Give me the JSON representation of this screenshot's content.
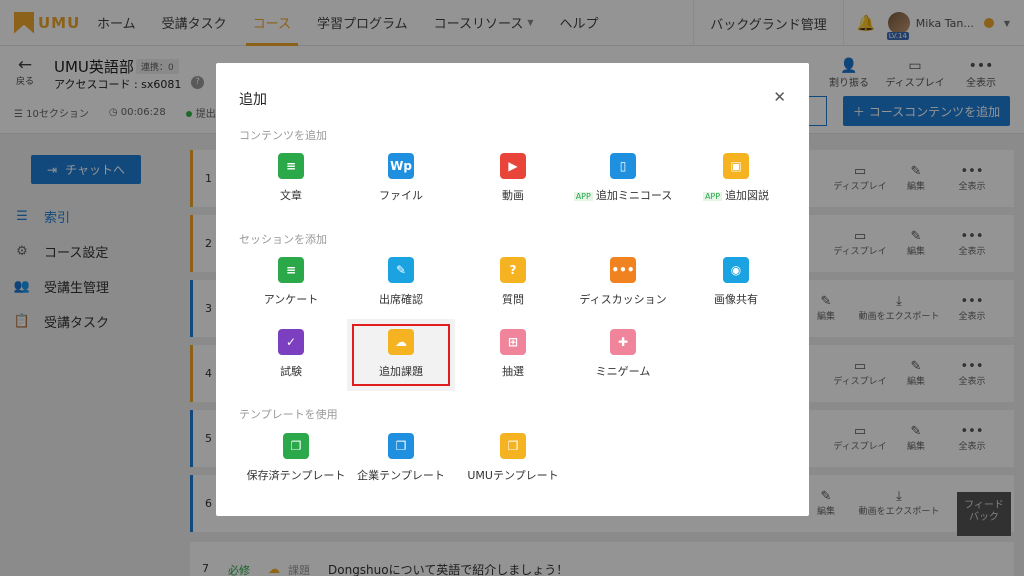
{
  "nav": {
    "logo": "UMU",
    "items": [
      {
        "label": "ホーム"
      },
      {
        "label": "受講タスク"
      },
      {
        "label": "コース"
      },
      {
        "label": "学習プログラム"
      },
      {
        "label": "コースリソース"
      },
      {
        "label": "ヘルプ"
      }
    ],
    "active_index": 2,
    "background_admin": "バックグランド管理",
    "user_name": "Mika Tan...",
    "user_level": "LV.14"
  },
  "course": {
    "back_label": "戻る",
    "title": "UMU英語部",
    "sync_tag": "連携：0",
    "access_code": "アクセスコード : sx6081",
    "sections": "10セクション",
    "duration": "00:06:28",
    "status": "提出",
    "actions": [
      {
        "icon": "person-add-icon",
        "label": "割り振る"
      },
      {
        "icon": "monitor-icon",
        "label": "ディスプレイ"
      },
      {
        "icon": "more-icon",
        "label": "全表示"
      }
    ],
    "add_content_button": "＋ コースコンテンツを追加"
  },
  "sidebar": {
    "chat_button": "チャットへ",
    "items": [
      {
        "label": "索引",
        "icon": "list-icon"
      },
      {
        "label": "コース設定",
        "icon": "gear-icon"
      },
      {
        "label": "受講生管理",
        "icon": "users-icon"
      },
      {
        "label": "受講タスク",
        "icon": "clipboard-icon"
      }
    ]
  },
  "rows": {
    "display": "ディスプレイ",
    "edit": "編集",
    "show_all": "全表示",
    "export_video": "動画をエクスポート",
    "numbers": [
      "1",
      "2",
      "3",
      "4",
      "5",
      "6",
      "7"
    ],
    "row7": {
      "required": "必修",
      "type": "課題",
      "title": "Dongshuoについて英語で紹介しましょう！"
    }
  },
  "feedback": "フィード\nバック",
  "modal": {
    "title": "追加",
    "sections": [
      {
        "label": "コンテンツを追加",
        "items": [
          {
            "label": "文章",
            "icon": "article-icon",
            "color": "#2aa84a"
          },
          {
            "label": "ファイル",
            "icon": "file-icon",
            "color": "#1f8fe0"
          },
          {
            "label": "動画",
            "icon": "video-icon",
            "color": "#e8443a"
          },
          {
            "label": "追加ミニコース",
            "icon": "mini-course-icon",
            "color": "#1f8fe0",
            "app": "APP"
          },
          {
            "label": "追加図説",
            "icon": "illustration-icon",
            "color": "#f5b221",
            "app": "APP"
          }
        ]
      },
      {
        "label": "セッションを添加",
        "items": [
          {
            "label": "アンケート",
            "icon": "survey-icon",
            "color": "#2aa84a"
          },
          {
            "label": "出席確認",
            "icon": "attendance-icon",
            "color": "#1aa3e0"
          },
          {
            "label": "質問",
            "icon": "question-icon",
            "color": "#f5b221"
          },
          {
            "label": "ディスカッション",
            "icon": "discussion-icon",
            "color": "#f08320"
          },
          {
            "label": "画像共有",
            "icon": "camera-icon",
            "color": "#1aa3e0"
          },
          {
            "label": "試験",
            "icon": "exam-icon",
            "color": "#7b3fbf"
          },
          {
            "label": "追加課題",
            "icon": "upload-cloud-icon",
            "color": "#f5b221"
          },
          {
            "label": "抽選",
            "icon": "gift-icon",
            "color": "#f0849a"
          },
          {
            "label": "ミニゲーム",
            "icon": "game-icon",
            "color": "#f0849a"
          }
        ]
      },
      {
        "label": "テンプレートを使用",
        "items": [
          {
            "label": "保存済テンプレート",
            "icon": "saved-template-icon",
            "color": "#2aa84a"
          },
          {
            "label": "企業テンプレート",
            "icon": "enterprise-template-icon",
            "color": "#1f8fe0"
          },
          {
            "label": "UMUテンプレート",
            "icon": "umu-template-icon",
            "color": "#f5b221"
          }
        ]
      }
    ]
  }
}
